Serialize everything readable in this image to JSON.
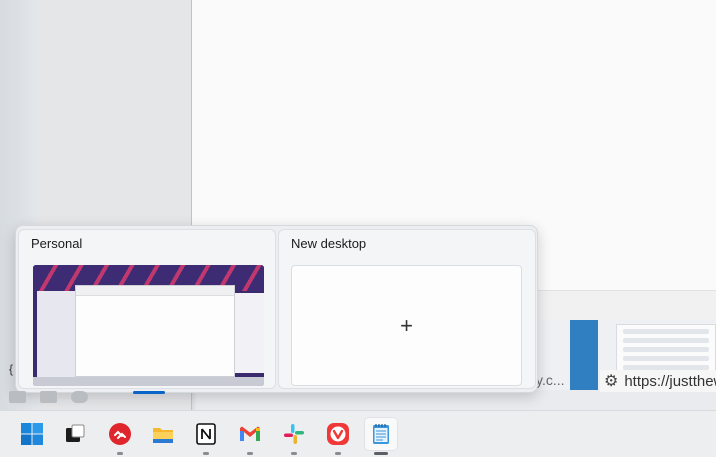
{
  "task_view": {
    "desktops": [
      {
        "name": "Personal",
        "active": true
      },
      {
        "name": "New desktop"
      }
    ],
    "add_symbol": "+"
  },
  "background": {
    "url_text": "https://justthew",
    "partial_text": "y.c...",
    "brace_text": "{"
  },
  "taskbar": {
    "items": [
      {
        "name": "start-button",
        "icon": "windows-logo-icon"
      },
      {
        "name": "task-view-button",
        "icon": "task-view-icon"
      },
      {
        "name": "authy-button",
        "icon": "authy-icon",
        "running": true
      },
      {
        "name": "file-explorer-button",
        "icon": "folder-icon"
      },
      {
        "name": "notion-button",
        "icon": "notion-icon",
        "running": true
      },
      {
        "name": "gmail-button",
        "icon": "gmail-icon",
        "running": true
      },
      {
        "name": "slack-button",
        "icon": "slack-icon",
        "running": true
      },
      {
        "name": "vivaldi-button",
        "icon": "vivaldi-icon",
        "running": true
      },
      {
        "name": "notepad-button",
        "icon": "notepad-icon",
        "running": true,
        "active": true
      }
    ]
  },
  "colors": {
    "accent": "#0a64c8",
    "authy": "#e0262d",
    "vivaldi": "#ef3939",
    "folder": "#f5b82e"
  }
}
